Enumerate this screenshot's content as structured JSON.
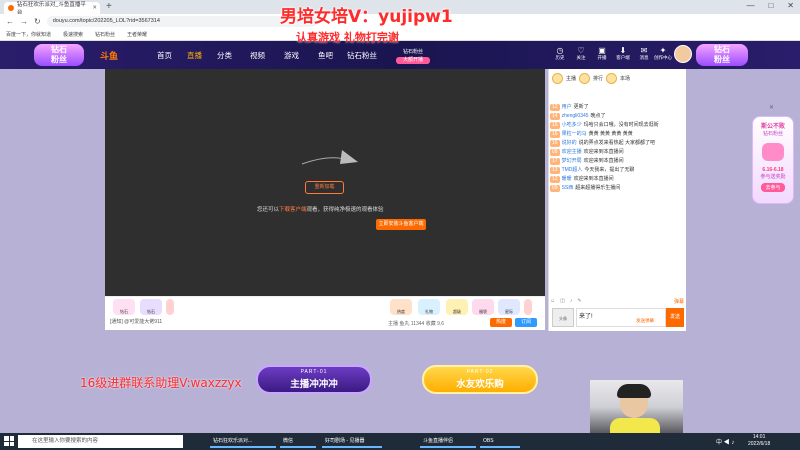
{
  "browser": {
    "tab_title": "钻石狂欢乐派对_斗鱼直播平台",
    "new_tab": "+",
    "window_controls": [
      "—",
      "□",
      "✕"
    ],
    "url": "douyu.com/topic/202205_LOL?rid=3567314",
    "bookmarks": [
      "百度一下，你就知道",
      "极速搜索",
      "钻石粉丝",
      "王者荣耀"
    ]
  },
  "overlay": {
    "title": "男培女培V：yujipw1",
    "subtitle": "认真游戏  礼物打完谢",
    "qq": "16级进群联系助理V:waxzzyx"
  },
  "nav": {
    "badge": "钻石\n粉丝",
    "logo": "斗鱼",
    "items": [
      "首页",
      "直播",
      "分类",
      "视频",
      "游戏",
      "鱼吧",
      "钻石粉丝"
    ],
    "promo": "钻石粉丝",
    "promo_tag": "大额开播",
    "icons": [
      "历史",
      "关注",
      "开播",
      "客户端",
      "消息",
      "创作中心"
    ],
    "right_badge": "钻石\n粉丝"
  },
  "player": {
    "reload": "重新加载",
    "msg_pre": "您还可以",
    "msg_hl": "下载客户端",
    "msg_post": "观看，获得纯净极速的观看体验",
    "install": "立即安装斗鱼客户端",
    "report": "[通知] @可爱能大佬911",
    "stats": "主播  鱼丸 11344  收藏 9.6",
    "hot": "热度",
    "follow": "订阅",
    "gifts": [
      "钻石",
      "钻石",
      "热度",
      "礼物",
      "超级",
      "福袋",
      "星际",
      "能量"
    ]
  },
  "chat": {
    "top": [
      "主播",
      "排行",
      "本场"
    ],
    "messages": [
      {
        "lv": "12",
        "name": "用户",
        "text": "更新了"
      },
      {
        "lv": "14",
        "name": "zhengli0345",
        "text": "晚点了"
      },
      {
        "lv": "15",
        "name": "小吃多少",
        "text": "玛哈只会口哦，没有时间现去逛街"
      },
      {
        "lv": "16",
        "name": "果粒一的马",
        "text": "黄黄 黄黄 黄黄 黄黄"
      },
      {
        "lv": "16",
        "name": "说好的",
        "text": "说的弄点发来看热起 大家都都了吧"
      },
      {
        "lv": "08",
        "name": "欢迎主播",
        "text": "欢迎来到本直播间"
      },
      {
        "lv": "17",
        "name": "梦幻开局",
        "text": "欢迎来到本直播间"
      },
      {
        "lv": "13",
        "name": "TMD超人",
        "text": "今天我来，提出了无聊"
      },
      {
        "lv": "12",
        "name": "暖暖",
        "text": "欢迎来到本直播间"
      },
      {
        "lv": "09",
        "name": "SS西",
        "text": "超来超播得乐生播间"
      }
    ],
    "tools": [
      "☺",
      "◫",
      "♪",
      "✎",
      "弹幕"
    ],
    "input_value": "来了!",
    "send_hint": "发送弹幕",
    "send": "发送",
    "avatar_label": "头像"
  },
  "promo": {
    "title": "斯公不败",
    "subtitle": "钻石粉丝",
    "date": "6.16-6.18",
    "note": "参与送奖励",
    "go": "去参与"
  },
  "banners": {
    "part1_small": "PART-01",
    "part1_big": "主播冲冲冲",
    "part2_small": "PART-02",
    "part2_big": "水友欢乐购"
  },
  "taskbar": {
    "search_placeholder": "在这里输入你要搜索的内容",
    "tasks": [
      "钻石狂欢乐派对...",
      "微信",
      "好司剧场 - 见播器",
      "斗鱼直播伴侣",
      "OBS"
    ],
    "time": "14:01",
    "date": "2022/6/18",
    "tray": "中 ◀ ♪"
  },
  "colors": {
    "accent": "#ff6a00",
    "nav_bg": "#1a1550",
    "overlay_red": "#ff2a2a"
  }
}
